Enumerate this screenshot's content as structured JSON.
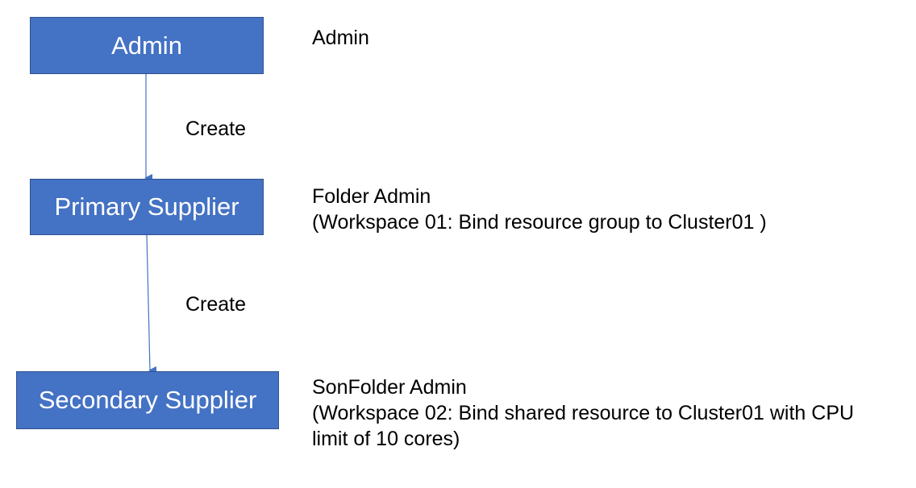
{
  "nodes": {
    "admin": "Admin",
    "primary": "Primary Supplier",
    "secondary": "Secondary Supplier"
  },
  "edges": {
    "admin_to_primary": "Create",
    "primary_to_secondary": "Create"
  },
  "descriptions": {
    "admin": {
      "line1": "Admin"
    },
    "primary": {
      "line1": "Folder Admin",
      "line2": "(Workspace 01: Bind resource group to Cluster01 )"
    },
    "secondary": {
      "line1": "SonFolder Admin",
      "line2": "(Workspace 02: Bind shared resource to Cluster01 with CPU",
      "line3": "limit of 10 cores)"
    }
  },
  "colors": {
    "node_fill": "#4472c4",
    "node_border": "#2f528f",
    "node_text": "#ffffff",
    "arrow": "#4472c4"
  }
}
